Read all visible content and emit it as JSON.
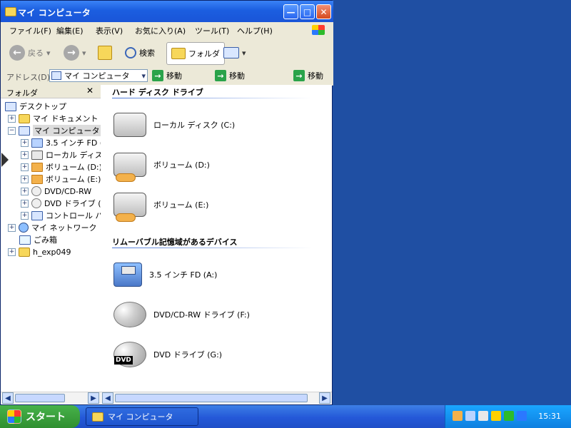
{
  "window": {
    "title": "マイ コンピュータ",
    "buttons": {
      "minimize": "—",
      "maximize": "□",
      "close": "✕"
    },
    "menu": [
      "ファイル(F)",
      "編集(E)",
      "表示(V)",
      "お気に入り(A)",
      "ツール(T)",
      "ヘルプ(H)"
    ],
    "toolbar": {
      "back": "戻る",
      "search": "検索",
      "folders": "フォルダ"
    },
    "address": {
      "label": "アドレス(D)",
      "value": "マイ コンピュータ",
      "go_label": "移動",
      "go_label_2": "移動",
      "go_label_3": "移動"
    },
    "tree": {
      "header": "フォルダ",
      "close": "✕",
      "items": [
        {
          "label": "デスクトップ"
        },
        {
          "label": "マイ ドキュメント"
        },
        {
          "label": "マイ コンピュータ"
        },
        {
          "label": "3.5 インチ FD ("
        },
        {
          "label": "ローカル ディスク"
        },
        {
          "label": "ボリューム (D:)"
        },
        {
          "label": "ボリューム (E:)"
        },
        {
          "label": "DVD/CD-RW"
        },
        {
          "label": "DVD ドライブ ("
        },
        {
          "label": "コントロール パ"
        },
        {
          "label": "マイ ネットワーク"
        },
        {
          "label": "ごみ箱"
        },
        {
          "label": "h_exp049"
        }
      ]
    },
    "content": {
      "groups": [
        {
          "title": "ハード ディスク ドライブ",
          "items": [
            {
              "label": "ローカル ディスク (C:)"
            },
            {
              "label": "ボリューム (D:)"
            },
            {
              "label": "ボリューム (E:)"
            }
          ]
        },
        {
          "title": "リムーバブル記憶域があるデバイス",
          "items": [
            {
              "label": "3.5 インチ FD (A:)"
            },
            {
              "label": "DVD/CD-RW ドライブ (F:)"
            },
            {
              "label": "DVD ドライブ (G:)"
            }
          ]
        }
      ],
      "dvd_badge": "DVD"
    }
  },
  "taskbar": {
    "start": "スタート",
    "task": "マイ コンピュータ",
    "time": "15:31"
  },
  "colors": {
    "desktop": "#1f4fa3",
    "titlebar": "#1b5ee0",
    "start_green": "#2f8f30"
  }
}
